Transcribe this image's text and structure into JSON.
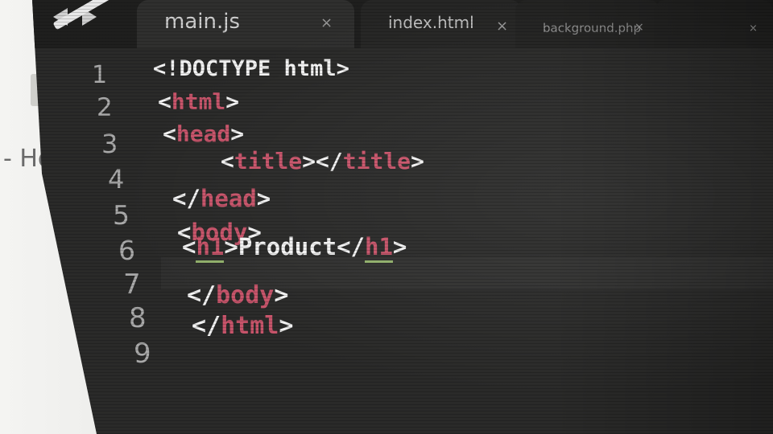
{
  "background": {
    "side_text": "- Ho"
  },
  "tabs": [
    {
      "label": "main.js",
      "close": "×",
      "active": true
    },
    {
      "label": "index.html",
      "close": "×",
      "active": false
    },
    {
      "label": "background.php",
      "close": "×",
      "active": false
    },
    {
      "label": "",
      "close": "×",
      "active": false
    }
  ],
  "gutter": {
    "line_numbers": [
      "1",
      "2",
      "3",
      "4",
      "5",
      "6",
      "7",
      "8",
      "9"
    ]
  },
  "code": {
    "lines": [
      [
        {
          "t": "txt",
          "v": "<!DOCTYPE html>"
        }
      ],
      [
        {
          "t": "txt",
          "v": "<"
        },
        {
          "t": "tag",
          "v": "html"
        },
        {
          "t": "txt",
          "v": ">"
        }
      ],
      [
        {
          "t": "txt",
          "v": "<"
        },
        {
          "t": "tag",
          "v": "head"
        },
        {
          "t": "txt",
          "v": ">"
        }
      ],
      [
        {
          "t": "txt",
          "v": "<"
        },
        {
          "t": "tag",
          "v": "title"
        },
        {
          "t": "txt",
          "v": "></"
        },
        {
          "t": "tag",
          "v": "title"
        },
        {
          "t": "txt",
          "v": ">"
        }
      ],
      [
        {
          "t": "txt",
          "v": "</"
        },
        {
          "t": "tag",
          "v": "head"
        },
        {
          "t": "txt",
          "v": ">"
        }
      ],
      [
        {
          "t": "txt",
          "v": "<"
        },
        {
          "t": "tag",
          "v": "body"
        },
        {
          "t": "txt",
          "v": ">"
        }
      ],
      [
        {
          "t": "txt",
          "v": "<"
        },
        {
          "t": "tag",
          "v": "h1",
          "u": true
        },
        {
          "t": "txt",
          "v": ">Product</"
        },
        {
          "t": "tag",
          "v": "h1",
          "u": true
        },
        {
          "t": "txt",
          "v": ">"
        }
      ],
      [
        {
          "t": "txt",
          "v": "</"
        },
        {
          "t": "tag",
          "v": "body"
        },
        {
          "t": "txt",
          "v": ">"
        }
      ],
      [
        {
          "t": "txt",
          "v": "</"
        },
        {
          "t": "tag",
          "v": "html"
        },
        {
          "t": "txt",
          "v": ">"
        }
      ],
      []
    ]
  },
  "colors": {
    "tag": "#c7546a",
    "text": "#f2f2f2",
    "line_number": "#a9a9a9",
    "editor_bg": "#2a2a29"
  }
}
